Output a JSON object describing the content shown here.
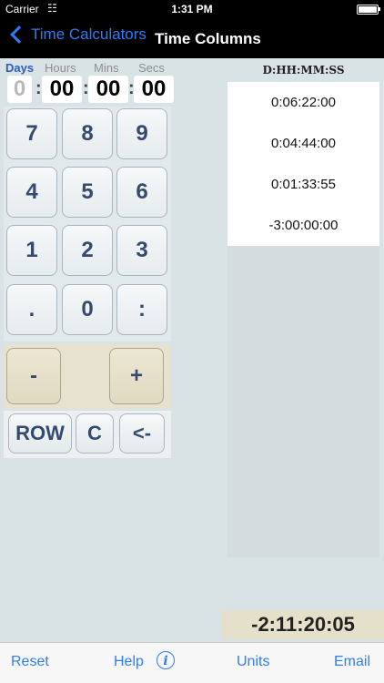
{
  "status_bar": {
    "carrier": "Carrier",
    "time": "1:31 PM"
  },
  "nav": {
    "back_label": "Time Calculators",
    "title": "Time Columns"
  },
  "input": {
    "labels": {
      "days": "Days",
      "hours": "Hours",
      "mins": "Mins",
      "secs": "Secs"
    },
    "values": {
      "days": "0",
      "hours": "00",
      "mins": "00",
      "secs": "00"
    },
    "separator": ":"
  },
  "keypad": {
    "keys": [
      "7",
      "8",
      "9",
      "4",
      "5",
      "6",
      "1",
      "2",
      "3",
      ".",
      "0",
      ":"
    ],
    "minus": "-",
    "plus": "+",
    "row": "ROW",
    "clear": "C",
    "backspace": "<-"
  },
  "column": {
    "header": "D:HH:MM:SS",
    "rows": [
      "0:06:22:00",
      "0:04:44:00",
      "0:01:33:55",
      "-3:00:00:00"
    ]
  },
  "total": "-2:11:20:05",
  "toolbar": {
    "reset": "Reset",
    "help": "Help",
    "units": "Units",
    "email": "Email"
  },
  "colors": {
    "accent": "#2f7cf6",
    "key_text": "#344a70",
    "days_label": "#2a5cc4"
  }
}
